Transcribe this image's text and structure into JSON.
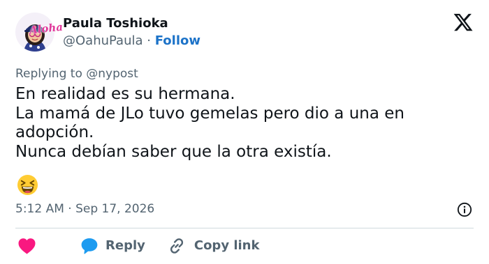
{
  "author": {
    "display_name": "Paula Toshioka",
    "handle": "@OahuPaula",
    "separator": "·",
    "follow_label": "Follow",
    "avatar_badge": "Aloha"
  },
  "tweet": {
    "replying_to": "Replying to @nypost",
    "lines": [
      "En realidad es su hermana.",
      "La mamá de JLo tuvo gemelas pero dio a una en",
      "adopción.",
      "Nunca debían saber que la otra existía."
    ],
    "emoji": "laughing-face",
    "timestamp": "5:12 AM · Sep 17, 2026"
  },
  "actions": {
    "reply_label": "Reply",
    "copy_link_label": "Copy link"
  },
  "icons": {
    "logo": "x-logo-icon",
    "info": "info-icon",
    "like": "heart-icon",
    "reply": "speech-bubble-icon",
    "copy": "link-icon"
  },
  "colors": {
    "text": "#0f1419",
    "secondary": "#536471",
    "follow": "#1d73c8",
    "heart": "#f91880",
    "reply_bubble": "#1d9bf0",
    "divider": "#cfd9de"
  }
}
